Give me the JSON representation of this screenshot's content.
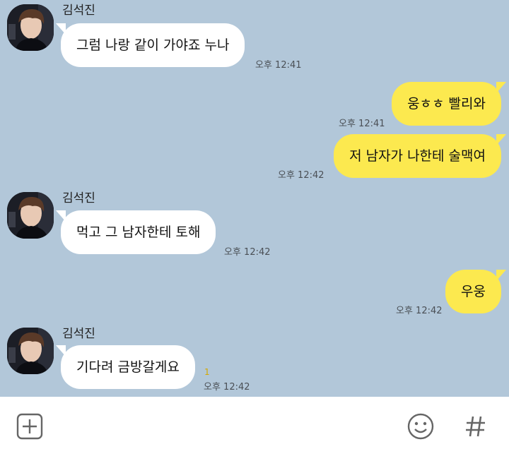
{
  "messages": [
    {
      "sender": "김석진",
      "text": "그럼 나랑 같이 가야죠 누나",
      "time": "오후 12:41"
    },
    {
      "text": "웅ㅎㅎ 빨리와",
      "time": "오후 12:41"
    },
    {
      "text": "저 남자가 나한테 술맥여",
      "time": "오후 12:42"
    },
    {
      "sender": "김석진",
      "text": "먹고 그 남자한테 토해",
      "time": "오후 12:42"
    },
    {
      "text": "우웅",
      "time": "오후 12:42"
    },
    {
      "sender": "김석진",
      "text": "기다려 금방갈게요",
      "time": "오후 12:42",
      "unread": "1"
    }
  ],
  "colors": {
    "background": "#b2c7d9",
    "incoming_bubble": "#ffffff",
    "outgoing_bubble": "#fce94f",
    "input_bar": "#ffffff",
    "icon": "#666666"
  },
  "input_bar": {
    "icons": [
      "add-icon",
      "emoji-icon",
      "hashtag-icon"
    ]
  }
}
